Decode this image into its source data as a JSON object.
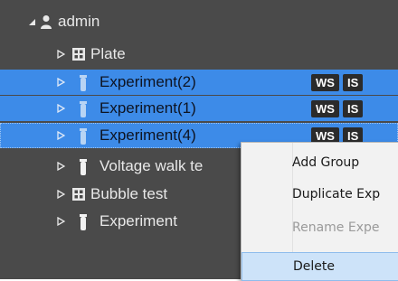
{
  "tree": {
    "root_label": "admin",
    "items": [
      {
        "label": "Plate",
        "badges": []
      },
      {
        "label": "Experiment(2)",
        "badges": [
          "WS",
          "IS"
        ]
      },
      {
        "label": "Experiment(1)",
        "badges": [
          "WS",
          "IS"
        ]
      },
      {
        "label": "Experiment(4)",
        "badges": [
          "WS",
          "IS"
        ]
      },
      {
        "label": "Voltage walk te",
        "badges": []
      },
      {
        "label": "Bubble test",
        "badges": []
      },
      {
        "label": "Experiment",
        "badges": []
      }
    ]
  },
  "context_menu": {
    "items": [
      {
        "label": "Add Group",
        "enabled": true
      },
      {
        "label": "Duplicate Exp",
        "enabled": true
      },
      {
        "label": "Rename Expe",
        "enabled": false
      },
      {
        "label": "Delete",
        "enabled": true
      }
    ]
  },
  "colors": {
    "selection": "#3d8be8",
    "tree_background": "#4a4a4a"
  }
}
